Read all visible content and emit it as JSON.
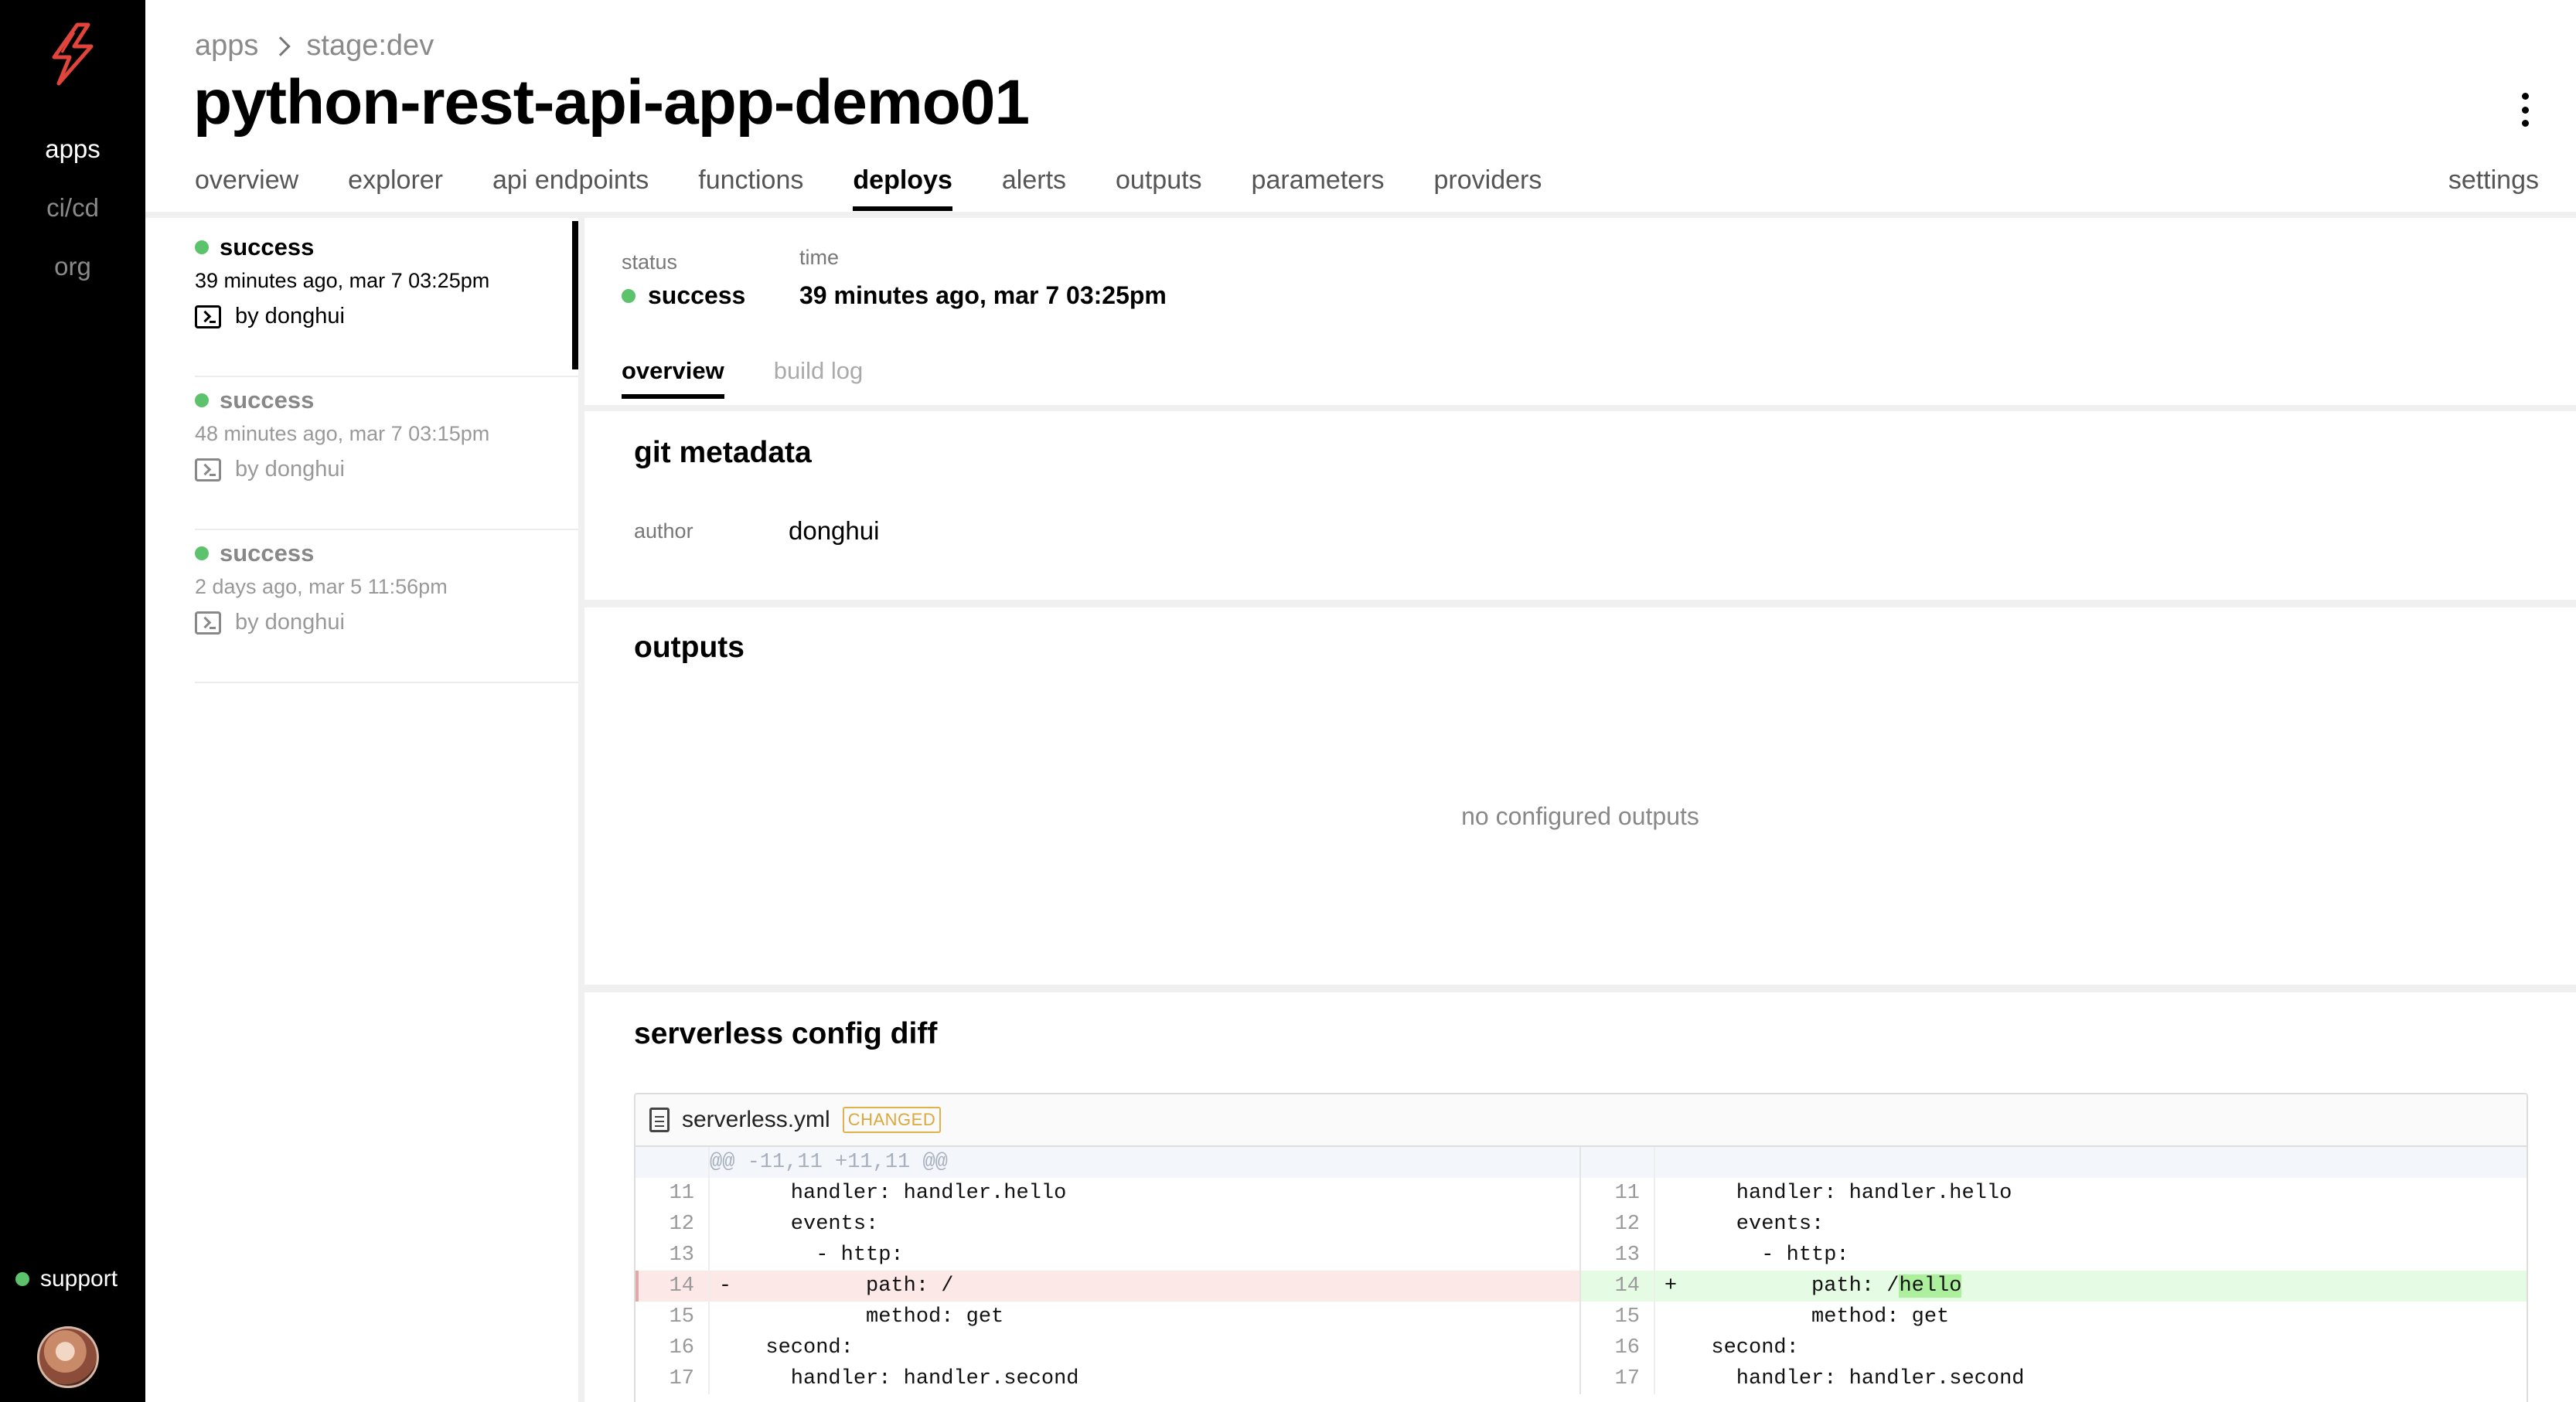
{
  "nav": {
    "items": [
      {
        "label": "apps",
        "active": true
      },
      {
        "label": "ci/cd",
        "active": false
      },
      {
        "label": "org",
        "active": false
      }
    ],
    "support_label": "support"
  },
  "header": {
    "breadcrumb": [
      "apps",
      "stage:dev"
    ],
    "title": "python-rest-api-app-demo01",
    "tabs": [
      "overview",
      "explorer",
      "api endpoints",
      "functions",
      "deploys",
      "alerts",
      "outputs",
      "parameters",
      "providers"
    ],
    "active_tab": "deploys",
    "settings_label": "settings"
  },
  "deploys": [
    {
      "status": "success",
      "time": "39 minutes ago, mar 7 03:25pm",
      "by": "by donghui"
    },
    {
      "status": "success",
      "time": "48 minutes ago, mar 7 03:15pm",
      "by": "by donghui"
    },
    {
      "status": "success",
      "time": "2 days ago, mar 5 11:56pm",
      "by": "by donghui"
    }
  ],
  "detail": {
    "status_label": "status",
    "status_value": "success",
    "time_label": "time",
    "time_value": "39 minutes ago, mar 7 03:25pm",
    "subtabs": [
      "overview",
      "build log"
    ],
    "git": {
      "title": "git metadata",
      "author_label": "author",
      "author_value": "donghui"
    },
    "outputs": {
      "title": "outputs",
      "empty": "no configured outputs"
    },
    "diff": {
      "title": "serverless config diff",
      "filename": "serverless.yml",
      "badge": "CHANGED",
      "hunk": "@@ -11,11 +11,11 @@",
      "left_rows": [
        {
          "n": "11",
          "mark": "",
          "code": "    handler: handler.hello",
          "type": "ctx"
        },
        {
          "n": "12",
          "mark": "",
          "code": "    events:",
          "type": "ctx"
        },
        {
          "n": "13",
          "mark": "",
          "code": "      - http:",
          "type": "ctx"
        },
        {
          "n": "14",
          "mark": "-",
          "code": "          path: /",
          "type": "del"
        },
        {
          "n": "15",
          "mark": "",
          "code": "          method: get",
          "type": "ctx"
        },
        {
          "n": "16",
          "mark": "",
          "code": "  second:",
          "type": "ctx"
        },
        {
          "n": "17",
          "mark": "",
          "code": "    handler: handler.second",
          "type": "ctx"
        }
      ],
      "right_rows": [
        {
          "n": "11",
          "mark": "",
          "code": "    handler: handler.hello",
          "type": "ctx"
        },
        {
          "n": "12",
          "mark": "",
          "code": "    events:",
          "type": "ctx"
        },
        {
          "n": "13",
          "mark": "",
          "code": "      - http:",
          "type": "ctx"
        },
        {
          "n": "14",
          "mark": "+",
          "code": "          path: /",
          "hl": "hello",
          "type": "add"
        },
        {
          "n": "15",
          "mark": "",
          "code": "          method: get",
          "type": "ctx"
        },
        {
          "n": "16",
          "mark": "",
          "code": "  second:",
          "type": "ctx"
        },
        {
          "n": "17",
          "mark": "",
          "code": "    handler: handler.second",
          "type": "ctx"
        }
      ]
    }
  },
  "colors": {
    "success": "#5cc26b",
    "accent": "#e0443a",
    "removed_bg": "#fde8e8",
    "added_bg": "#e6fbe3",
    "added_highlight": "#acef9c",
    "changed_badge": "#e1b14a"
  }
}
